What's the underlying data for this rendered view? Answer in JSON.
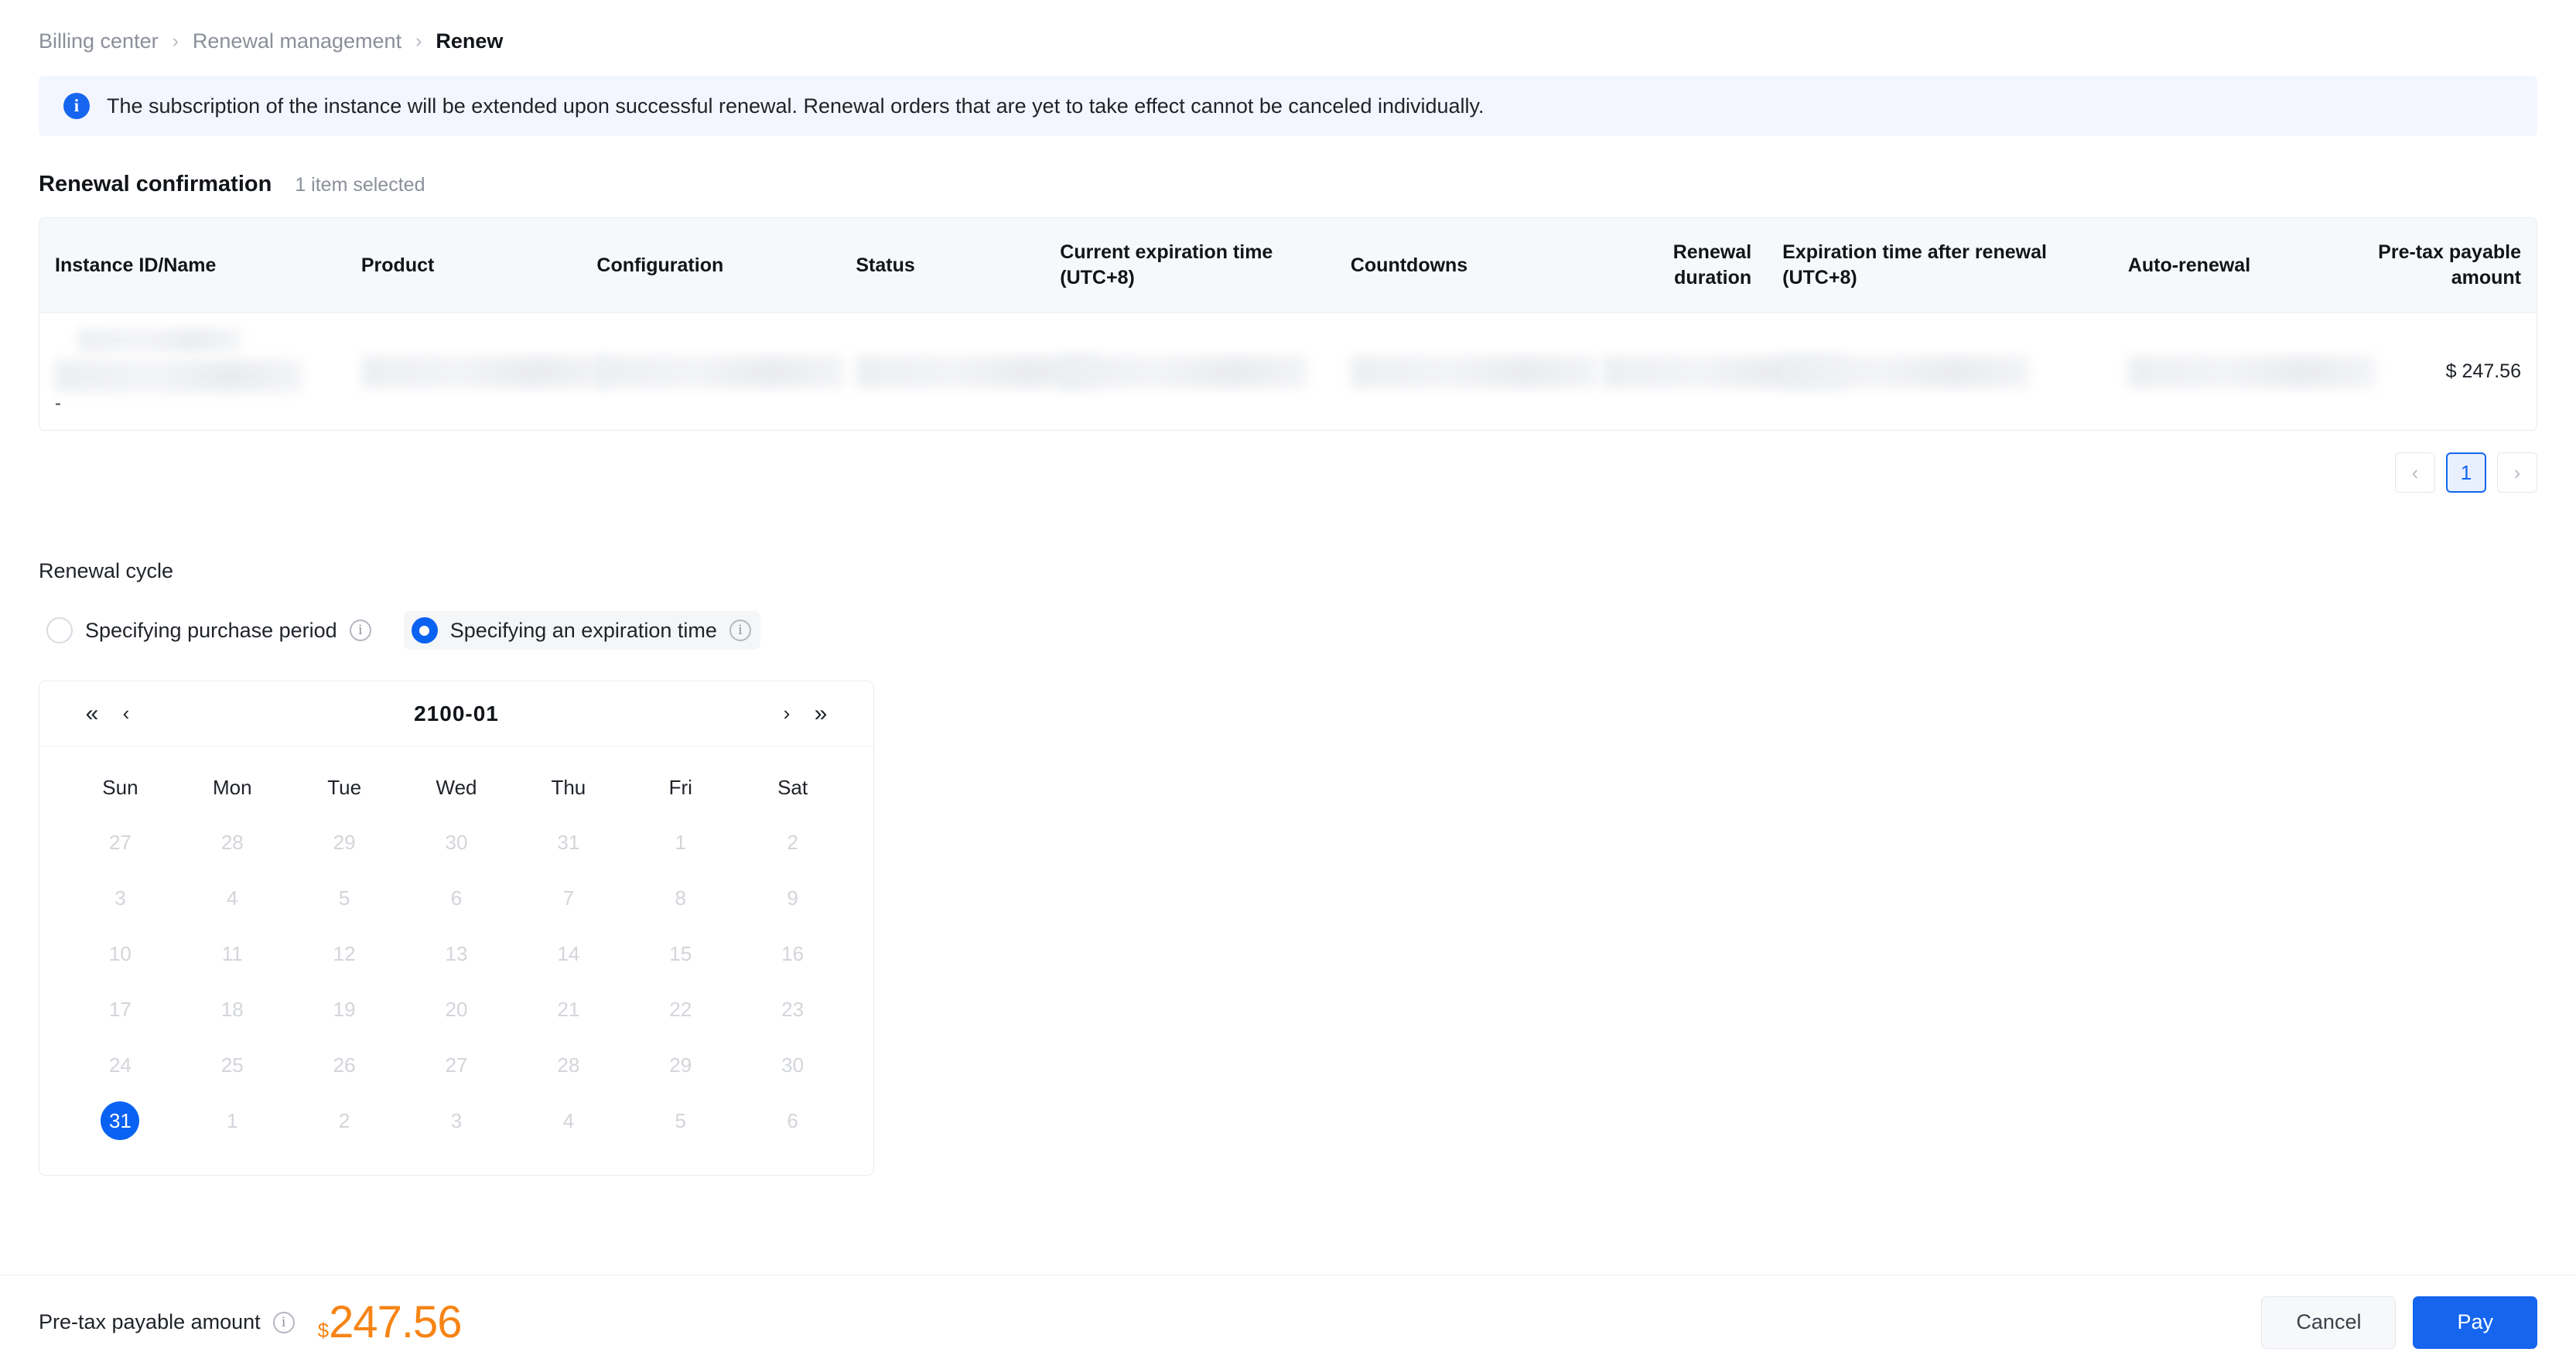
{
  "breadcrumb": {
    "items": [
      {
        "label": "Billing center",
        "current": false
      },
      {
        "label": "Renewal management",
        "current": false
      },
      {
        "label": "Renew",
        "current": true
      }
    ],
    "separator": "›"
  },
  "alert": {
    "icon": "info-icon",
    "icon_glyph": "i",
    "text": "The subscription of the instance will be extended upon successful renewal. Renewal orders that are yet to take effect cannot be canceled individually."
  },
  "confirmation": {
    "title": "Renewal confirmation",
    "selection_text": "1 item selected"
  },
  "table": {
    "columns": [
      "Instance ID/Name",
      "Product",
      "Configuration",
      "Status",
      "Current expiration time (UTC+8)",
      "Countdowns",
      "Renewal duration",
      "Expiration time after renewal (UTC+8)",
      "Auto-renewal",
      "Pre-tax payable amount"
    ],
    "rows": [
      {
        "instance": "",
        "instance_dash": "-",
        "product": "",
        "configuration": "",
        "status": "",
        "current_expiration": "",
        "countdowns": "",
        "renewal_duration": "",
        "expiration_after_renewal": "",
        "auto_renewal": "",
        "pretax_amount": "$ 247.56"
      }
    ]
  },
  "pagination": {
    "prev": "‹",
    "next": "›",
    "pages": [
      "1"
    ],
    "active_page": "1"
  },
  "renewal_cycle": {
    "title": "Renewal cycle",
    "options": [
      {
        "label": "Specifying purchase period",
        "selected": false
      },
      {
        "label": "Specifying an expiration time",
        "selected": true
      }
    ],
    "help_glyph": "i"
  },
  "calendar": {
    "title": "2100-01",
    "nav": {
      "prev_year": "«",
      "prev_month": "‹",
      "next_month": "›",
      "next_year": "»"
    },
    "weekdays": [
      "Sun",
      "Mon",
      "Tue",
      "Wed",
      "Thu",
      "Fri",
      "Sat"
    ],
    "weeks": [
      [
        {
          "day": "27",
          "selected": false
        },
        {
          "day": "28",
          "selected": false
        },
        {
          "day": "29",
          "selected": false
        },
        {
          "day": "30",
          "selected": false
        },
        {
          "day": "31",
          "selected": false
        },
        {
          "day": "1",
          "selected": false
        },
        {
          "day": "2",
          "selected": false
        }
      ],
      [
        {
          "day": "3",
          "selected": false
        },
        {
          "day": "4",
          "selected": false
        },
        {
          "day": "5",
          "selected": false
        },
        {
          "day": "6",
          "selected": false
        },
        {
          "day": "7",
          "selected": false
        },
        {
          "day": "8",
          "selected": false
        },
        {
          "day": "9",
          "selected": false
        }
      ],
      [
        {
          "day": "10",
          "selected": false
        },
        {
          "day": "11",
          "selected": false
        },
        {
          "day": "12",
          "selected": false
        },
        {
          "day": "13",
          "selected": false
        },
        {
          "day": "14",
          "selected": false
        },
        {
          "day": "15",
          "selected": false
        },
        {
          "day": "16",
          "selected": false
        }
      ],
      [
        {
          "day": "17",
          "selected": false
        },
        {
          "day": "18",
          "selected": false
        },
        {
          "day": "19",
          "selected": false
        },
        {
          "day": "20",
          "selected": false
        },
        {
          "day": "21",
          "selected": false
        },
        {
          "day": "22",
          "selected": false
        },
        {
          "day": "23",
          "selected": false
        }
      ],
      [
        {
          "day": "24",
          "selected": false
        },
        {
          "day": "25",
          "selected": false
        },
        {
          "day": "26",
          "selected": false
        },
        {
          "day": "27",
          "selected": false
        },
        {
          "day": "28",
          "selected": false
        },
        {
          "day": "29",
          "selected": false
        },
        {
          "day": "30",
          "selected": false
        }
      ],
      [
        {
          "day": "31",
          "selected": true
        },
        {
          "day": "1",
          "selected": false
        },
        {
          "day": "2",
          "selected": false
        },
        {
          "day": "3",
          "selected": false
        },
        {
          "day": "4",
          "selected": false
        },
        {
          "day": "5",
          "selected": false
        },
        {
          "day": "6",
          "selected": false
        }
      ]
    ]
  },
  "footer": {
    "total_label": "Pre-tax payable amount",
    "help_glyph": "i",
    "currency": "$",
    "amount": "247.56",
    "cancel_label": "Cancel",
    "pay_label": "Pay"
  },
  "colors": {
    "accent_blue": "#1565ef",
    "radio_blue": "#0a62f2",
    "amount_orange": "#f68415",
    "alert_bg": "#f3f6fe",
    "header_bg": "#f7f8fa"
  }
}
